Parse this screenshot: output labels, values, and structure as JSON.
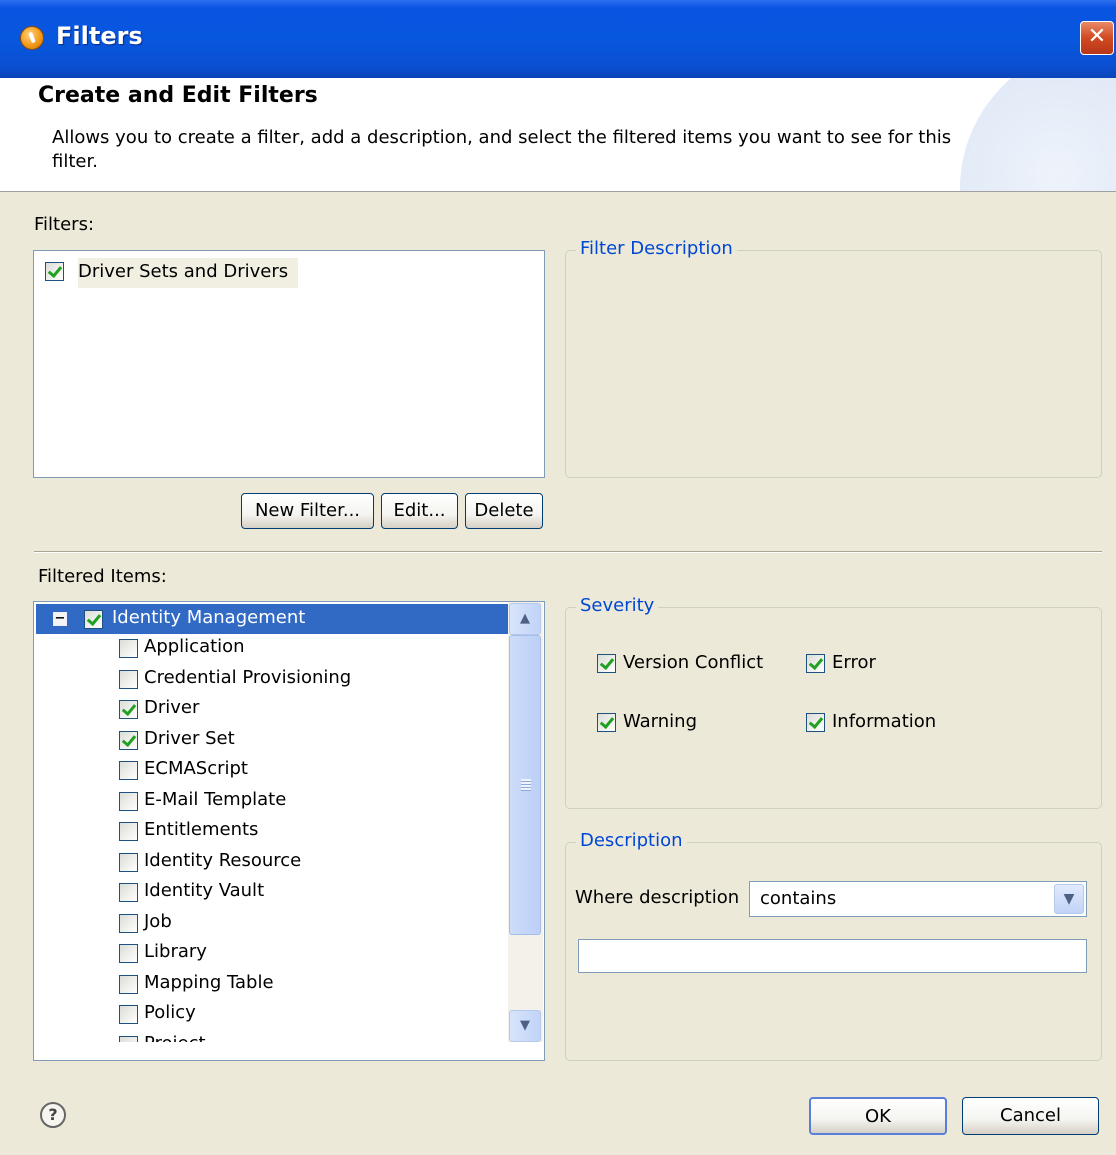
{
  "window": {
    "title": "Filters",
    "close_glyph": "✕"
  },
  "banner": {
    "title": "Create and Edit Filters",
    "description": "Allows you to create a filter, add a description, and select the filtered items you want to see for this filter."
  },
  "filters": {
    "label": "Filters:",
    "items": [
      {
        "label": "Driver Sets and Drivers",
        "checked": true
      }
    ],
    "buttons": {
      "new": "New Filter...",
      "edit": "Edit...",
      "delete": "Delete"
    }
  },
  "filter_description": {
    "legend": "Filter Description"
  },
  "filtered_items": {
    "label": "Filtered Items:",
    "root": {
      "label": "Identity Management",
      "checked": true,
      "expanded": true,
      "toggle_glyph": "−"
    },
    "children": [
      {
        "label": "Application",
        "checked": false
      },
      {
        "label": "Credential Provisioning",
        "checked": false
      },
      {
        "label": "Driver",
        "checked": true
      },
      {
        "label": "Driver Set",
        "checked": true
      },
      {
        "label": "ECMAScript",
        "checked": false
      },
      {
        "label": "E-Mail Template",
        "checked": false
      },
      {
        "label": "Entitlements",
        "checked": false
      },
      {
        "label": "Identity Resource",
        "checked": false
      },
      {
        "label": "Identity Vault",
        "checked": false
      },
      {
        "label": "Job",
        "checked": false
      },
      {
        "label": "Library",
        "checked": false
      },
      {
        "label": "Mapping Table",
        "checked": false
      },
      {
        "label": "Policy",
        "checked": false
      },
      {
        "label": "Project",
        "checked": false
      }
    ],
    "scroll_up_glyph": "▲",
    "scroll_down_glyph": "▼"
  },
  "severity": {
    "legend": "Severity",
    "options": [
      {
        "label": "Version Conflict",
        "checked": true
      },
      {
        "label": "Error",
        "checked": true
      },
      {
        "label": "Warning",
        "checked": true
      },
      {
        "label": "Information",
        "checked": true
      }
    ]
  },
  "description": {
    "legend": "Description",
    "where_label": "Where description",
    "operator": "contains",
    "dropdown_glyph": "▼",
    "value": ""
  },
  "footer": {
    "help_glyph": "?",
    "ok": "OK",
    "cancel": "Cancel"
  },
  "colors": {
    "titlebar": "#0757de",
    "selection": "#316ac5",
    "legend_text": "#0046d5",
    "dialog_bg": "#ece9d8",
    "check_mark": "#21a121"
  }
}
